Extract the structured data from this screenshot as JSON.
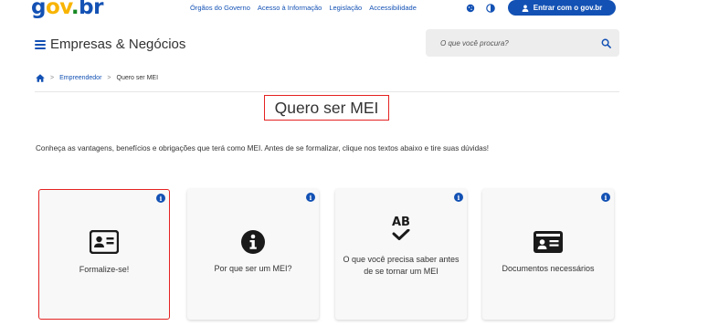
{
  "header": {
    "logo": {
      "g": "g",
      "ov": "ov",
      "dot": ".",
      "br": "br"
    },
    "links": [
      "Órgãos do Governo",
      "Acesso à Informação",
      "Legislação",
      "Accessibilidade"
    ],
    "login_label": "Entrar com o gov.br"
  },
  "subheader": {
    "site_title": "Empresas & Negócios",
    "search_placeholder": "O que você procura?"
  },
  "breadcrumb": {
    "items": [
      "Empreendedor",
      "Quero ser MEI"
    ]
  },
  "page": {
    "title": "Quero ser MEI",
    "intro": "Conheça as vantagens, benefícios e obrigações que terá como MEI. Antes de se formalizar, clique nos textos abaixo e tire suas dúvidas!"
  },
  "cards": [
    {
      "label": "Formalize-se!",
      "icon": "id-card-icon"
    },
    {
      "label": "Por que ser um MEI?",
      "icon": "info-circle-icon"
    },
    {
      "label": "O que você precisa saber antes de se tornar um MEI",
      "icon": "spell-check-icon",
      "icon_text": "AB"
    },
    {
      "label": "Documentos necessários",
      "icon": "id-document-icon"
    }
  ],
  "colors": {
    "brand_blue": "#1351b4",
    "brand_yellow": "#f8b400",
    "brand_green": "#168821",
    "highlight_red": "#e52222"
  }
}
